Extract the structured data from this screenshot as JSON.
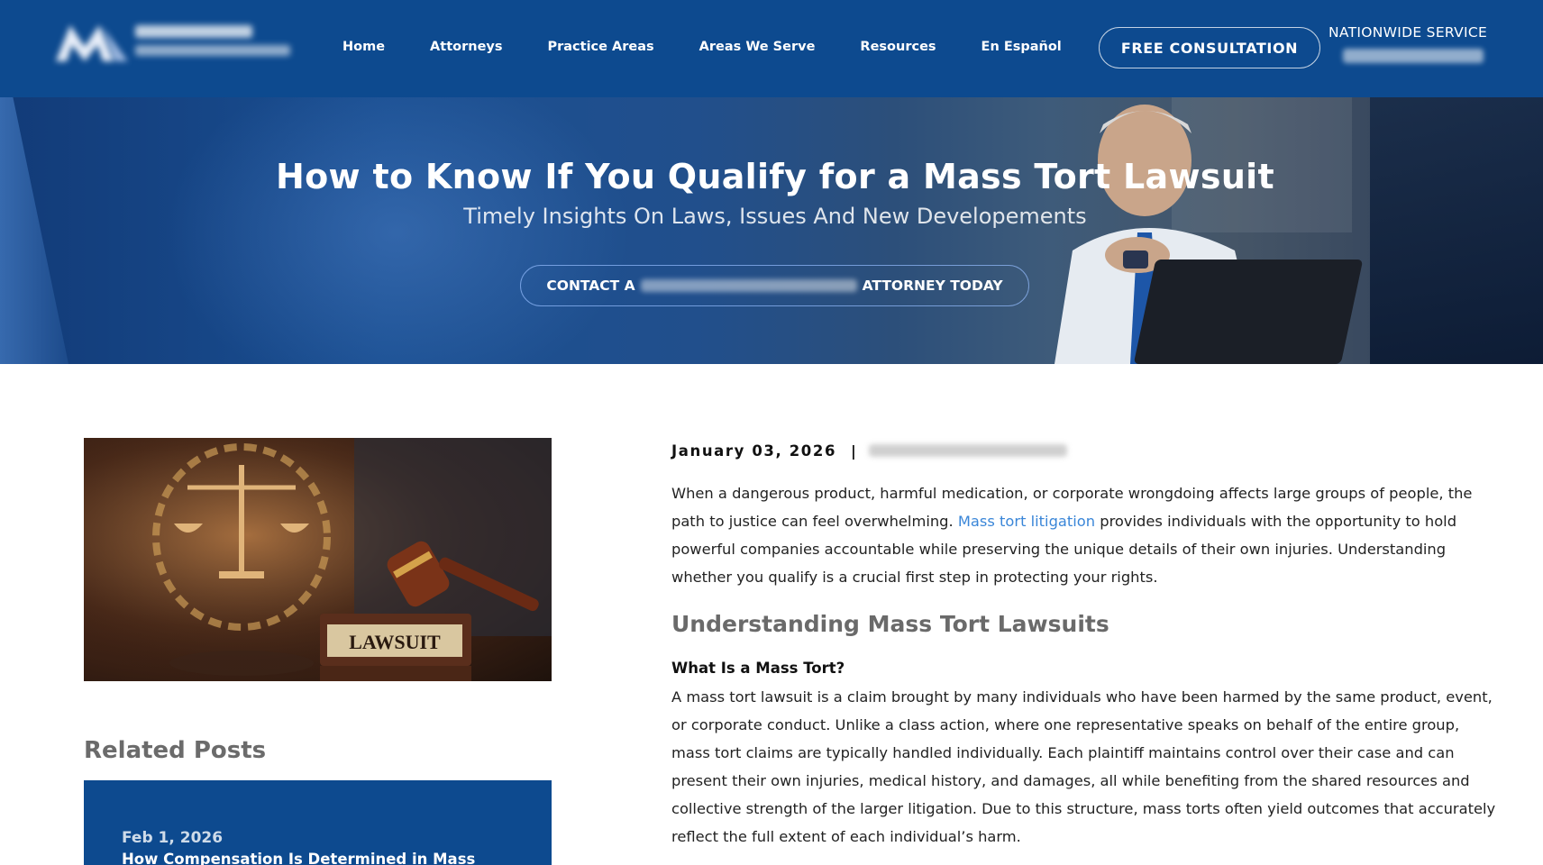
{
  "header": {
    "nav": [
      "Home",
      "Attorneys",
      "Practice Areas",
      "Areas We Serve",
      "Resources",
      "En Español"
    ],
    "consultation_label": "FREE CONSULTATION",
    "nationwide_label": "NATIONWIDE SERVICE"
  },
  "hero": {
    "title": "How to Know If You Qualify for a Mass Tort Lawsuit",
    "subtitle": "Timely Insights On Laws, Issues And New Developements",
    "cta_prefix": "CONTACT A",
    "cta_suffix": "ATTORNEY TODAY"
  },
  "featured_image": {
    "plaque_text": "LAWSUIT"
  },
  "sidebar": {
    "related_heading": "Related Posts",
    "related_posts": [
      {
        "date": "Feb 1, 2026",
        "title": "How Compensation Is Determined in Mass"
      }
    ]
  },
  "article": {
    "date": "January 03, 2026",
    "separator": "|",
    "intro_before_link": "When a dangerous product, harmful medication, or corporate wrongdoing affects large groups of people, the path to justice can feel overwhelming.",
    "intro_link": "Mass tort litigation",
    "intro_after_link": "provides individuals with the opportunity to hold powerful companies accountable while preserving the unique details of their own injuries. Understanding whether you qualify is a crucial first step in protecting your rights.",
    "section_heading": "Understanding Mass Tort Lawsuits",
    "sub_heading": "What Is a Mass Tort?",
    "body": "A mass tort lawsuit is a claim brought by many individuals who have been harmed by the same product, event, or corporate conduct. Unlike a class action, where one representative speaks on behalf of the entire group, mass tort claims are typically handled individually. Each plaintiff maintains control over their case and can present their own injuries, medical history, and damages, all while benefiting from the shared resources and collective strength of the larger litigation. Due to this structure, mass torts often yield outcomes that accurately reflect the full extent of each individual’s harm."
  },
  "colors": {
    "header_bg": "#0d4a8f",
    "link": "#3a86d8",
    "heading_gray": "#6a6a6a"
  }
}
